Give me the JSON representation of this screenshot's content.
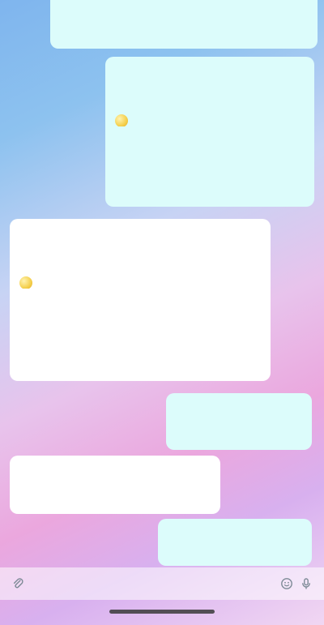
{
  "chat": {
    "messages": [
      {
        "direction": "out",
        "lines": [
          "",
          ""
        ],
        "time": ""
      },
      {
        "direction": "out",
        "lines": [
          "",
          "",
          "",
          "",
          "",
          "",
          "",
          ""
        ],
        "time": ""
      },
      {
        "direction": "in",
        "lines": [
          "",
          "",
          "",
          "",
          "",
          "",
          "",
          ""
        ],
        "time": ""
      },
      {
        "direction": "out",
        "lines": [
          "",
          "",
          ""
        ],
        "time": ""
      },
      {
        "direction": "in",
        "lines": [
          "",
          "",
          ""
        ],
        "time": ""
      },
      {
        "direction": "out",
        "lines": [
          "",
          "",
          ""
        ],
        "time": ""
      }
    ]
  },
  "composer": {
    "placeholder": "",
    "attach_icon": "attach-icon",
    "sticker_icon": "sticker-icon",
    "mic_icon": "microphone-icon"
  },
  "colors": {
    "bubble_out": "#dcfcfb",
    "bubble_in": "#ffffff",
    "gradient_top": "#7fb5ee",
    "gradient_mid": "#eba7de",
    "gradient_bottom": "#d8b0ef"
  }
}
